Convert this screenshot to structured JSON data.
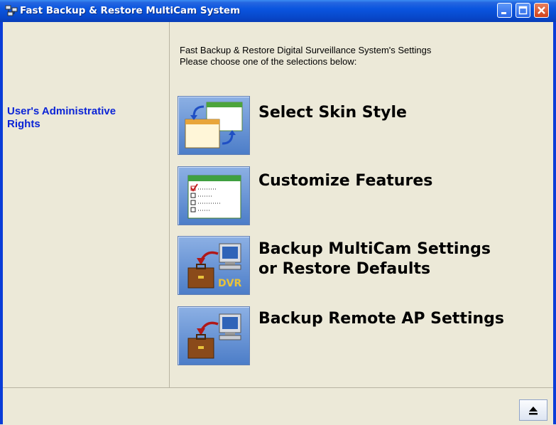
{
  "window": {
    "title": "Fast Backup & Restore MultiCam System"
  },
  "sidebar": {
    "label": "User's Administrative Rights"
  },
  "main": {
    "intro_line1": "Fast Backup & Restore Digital Surveillance System's Settings",
    "intro_line2": "Please choose one of the selections below:",
    "options": [
      {
        "label": "Select Skin Style",
        "icon": "skin-windows-icon"
      },
      {
        "label": "Customize Features",
        "icon": "checklist-window-icon"
      },
      {
        "label_line1": "Backup MultiCam Settings",
        "label_line2": "or Restore Defaults",
        "icon": "briefcase-dvr-icon",
        "badge": "DVR"
      },
      {
        "label": "Backup Remote AP Settings",
        "icon": "briefcase-monitor-icon"
      }
    ]
  },
  "statusbar": {
    "eject_icon": "eject-icon"
  },
  "colors": {
    "titlebar": "#0A55DF",
    "link_blue": "#0B24D6",
    "window_bg": "#ECE9D8"
  }
}
